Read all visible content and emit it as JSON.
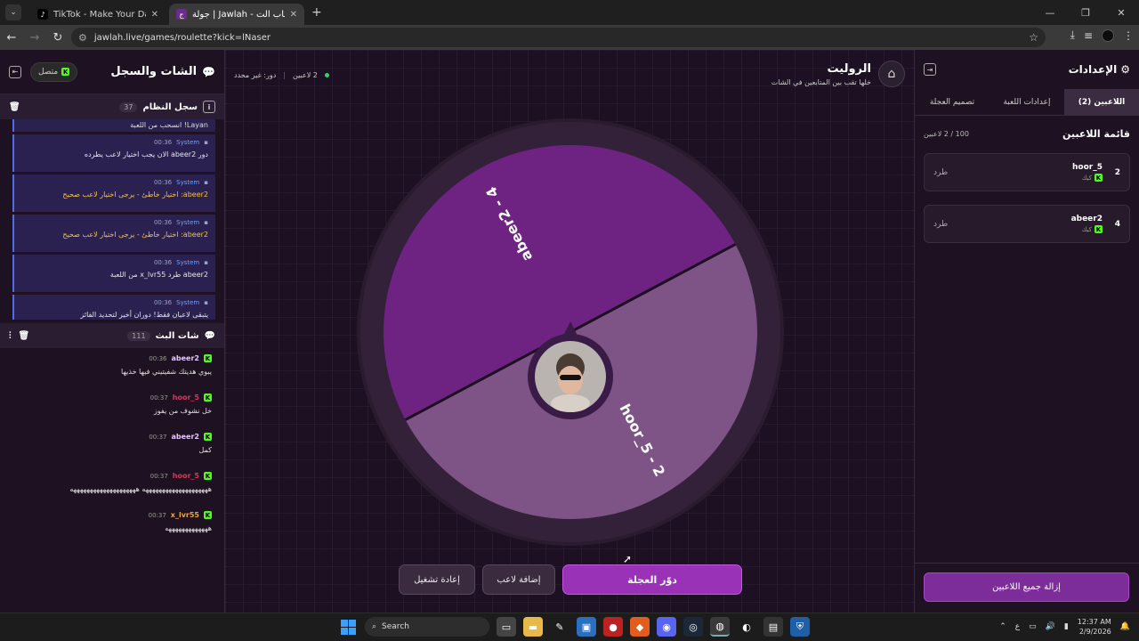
{
  "browser": {
    "tabs": [
      {
        "title": "TikTok - Make Your Day",
        "active": false
      },
      {
        "title": "جولة | Jawlah - منصة الألعاب الت...",
        "active": true
      }
    ],
    "url": "jawlah.live/games/roulette?kick=lNaser",
    "new_tab_label": "+"
  },
  "left": {
    "title": "الشات والسجل",
    "status": "متصل",
    "system_log": {
      "title": "سجل النظام",
      "count": "37",
      "first_partial": "Layan! انسحب من اللعبة",
      "messages": [
        {
          "user": "System",
          "time": "00:36",
          "text": "دور abeer2 الان يجب اختيار لاعب يطرده",
          "warn": false
        },
        {
          "user": "System",
          "time": "00:36",
          "text": "abeer2: اختيار خاطئ - يرجى اختيار لاعب صحيح",
          "warn": true
        },
        {
          "user": "System",
          "time": "00:36",
          "text": "abeer2: اختيار خاطئ - يرجى اختيار لاعب صحيح",
          "warn": true
        },
        {
          "user": "System",
          "time": "00:36",
          "text": "abeer2 طرد x_lvr55 من اللعبة",
          "warn": false
        },
        {
          "user": "System",
          "time": "00:36",
          "text": "يتبقى لاعبان فقط! دوران أخير لتحديد الفائز",
          "warn": false
        }
      ]
    },
    "stream_chat": {
      "title": "شات البث",
      "count": "111",
      "messages": [
        {
          "user": "abeer2",
          "time": "00:36",
          "text": "يبوي هديتك شفيتيني فيها خذيها",
          "color": "#e8c6ff"
        },
        {
          "user": "hoor_5",
          "time": "00:37",
          "text": "خل نشوف من يفوز",
          "color": "#e0335b"
        },
        {
          "user": "abeer2",
          "time": "00:37",
          "text": "كمل",
          "color": "#e8c6ff"
        },
        {
          "user": "hoor_5",
          "time": "00:37",
          "text": "ههههههههههههههههههههه ههههههههههههههههههههه",
          "color": "#e0335b"
        },
        {
          "user": "x_lvr55",
          "time": "00:37",
          "text": "هههههههههههههه",
          "color": "#f2a33a"
        }
      ]
    }
  },
  "center": {
    "title": "الروليت",
    "subtitle": "خلها تقب بين المتابعين في الشات",
    "players_count": "2 لاعبين",
    "turn": "دور: غير محدد",
    "wheel": {
      "segments": [
        {
          "label": "abeer2 - 4",
          "color": "#6e2383"
        },
        {
          "label": "hoor_5 - 2",
          "color": "#7d5485"
        }
      ]
    },
    "buttons": {
      "spin": "دوّر العجلة",
      "add": "إضافة لاعب",
      "restart": "إعادة تشغيل"
    }
  },
  "right": {
    "title": "الإعدادات",
    "tabs": [
      "اللاعبين (2)",
      "إعدادات اللعبة",
      "تصميم العجلة"
    ],
    "list_title": "قائمة اللاعبين",
    "list_count": "100 / 2 لاعبين",
    "players": [
      {
        "name": "hoor_5",
        "number": "2",
        "platform": "كيك",
        "kick_label": "طرد"
      },
      {
        "name": "abeer2",
        "number": "4",
        "platform": "كيك",
        "kick_label": "طرد"
      }
    ],
    "remove_all": "إزالة جميع اللاعبين"
  },
  "taskbar": {
    "search_placeholder": "Search",
    "time": "12:37 AM",
    "date": "2/9/2026",
    "lang": "ع"
  }
}
